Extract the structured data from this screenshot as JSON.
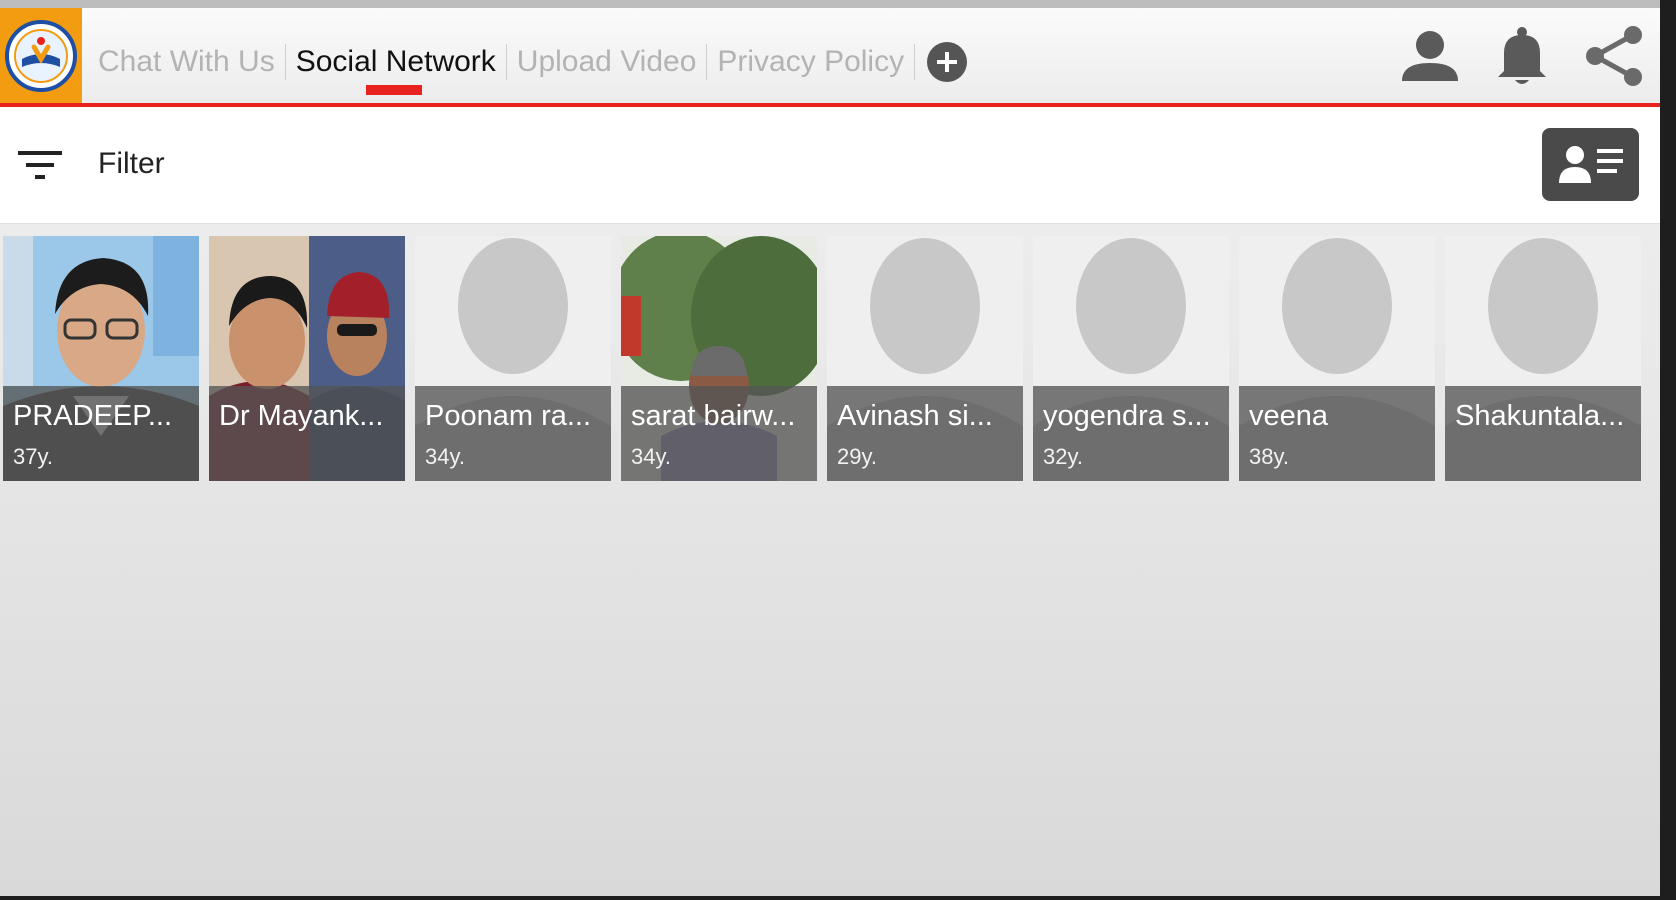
{
  "app": {
    "logo_name": "app-logo"
  },
  "tabs": [
    {
      "label": "Chat With Us",
      "active": false
    },
    {
      "label": "Social Network",
      "active": true
    },
    {
      "label": "Upload Video",
      "active": false
    },
    {
      "label": "Privacy Policy",
      "active": false
    }
  ],
  "icons": {
    "add_tab": "plus-circle-icon",
    "profile": "person-icon",
    "notifications": "bell-icon",
    "share": "share-icon",
    "filter": "filter-icon",
    "card_view": "contact-card-icon"
  },
  "filter": {
    "label": "Filter"
  },
  "colors": {
    "accent": "#e8231f",
    "logo_bg": "#f39c12",
    "caption_overlay": "#555555"
  },
  "profiles": [
    {
      "name": "PRADEEP...",
      "age": "37y.",
      "photo": "person-photo"
    },
    {
      "name": "Dr Mayank...",
      "age": "",
      "photo": "person-photo"
    },
    {
      "name": "Poonam ra...",
      "age": "34y.",
      "photo": "placeholder-silhouette"
    },
    {
      "name": "sarat bairw...",
      "age": "34y.",
      "photo": "person-photo"
    },
    {
      "name": "Avinash si...",
      "age": "29y.",
      "photo": "placeholder-silhouette"
    },
    {
      "name": "yogendra s...",
      "age": "32y.",
      "photo": "placeholder-silhouette"
    },
    {
      "name": "veena",
      "age": "38y.",
      "photo": "placeholder-silhouette"
    },
    {
      "name": "Shakuntala...",
      "age": "",
      "photo": "placeholder-silhouette"
    }
  ]
}
